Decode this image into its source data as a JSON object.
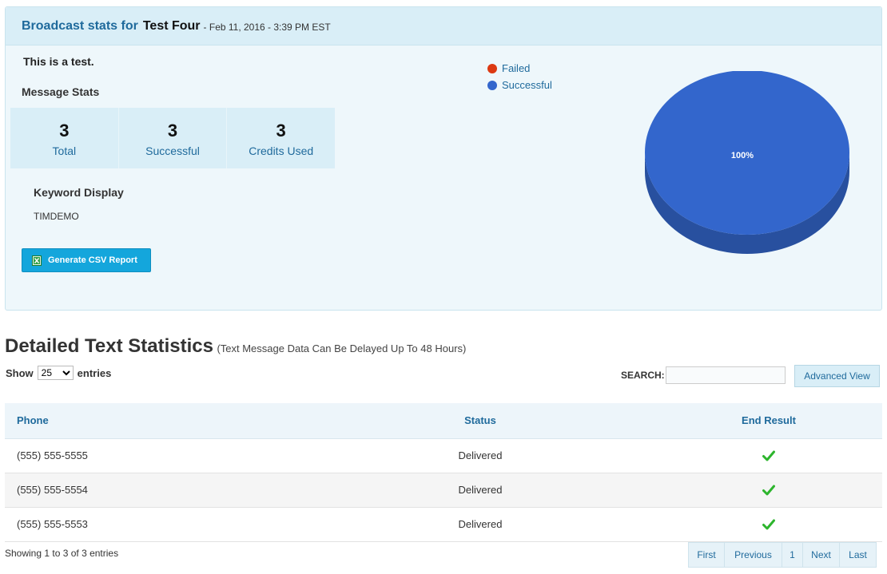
{
  "header": {
    "prefix": "Broadcast stats for",
    "name": "Test Four",
    "date": "- Feb 11, 2016 - 3:39 PM EST"
  },
  "description": "This is a test.",
  "message_stats": {
    "title": "Message Stats",
    "items": [
      {
        "value": "3",
        "label": "Total"
      },
      {
        "value": "3",
        "label": "Successful"
      },
      {
        "value": "3",
        "label": "Credits Used"
      }
    ]
  },
  "keyword": {
    "title": "Keyword Display",
    "value": "TIMDEMO"
  },
  "csv_button": {
    "label": "Generate CSV Report",
    "icon": "excel-icon"
  },
  "chart_data": {
    "type": "pie",
    "slices": [
      {
        "label": "Failed",
        "value": 0,
        "color": "#dc3912"
      },
      {
        "label": "Successful",
        "value": 100,
        "color": "#3366cc"
      }
    ],
    "data_label": "100%",
    "legend_position": "top-left",
    "style": "3d"
  },
  "detail": {
    "title": "Detailed Text Statistics",
    "subtitle": "(Text Message Data Can Be Delayed Up To 48 Hours)"
  },
  "length_control": {
    "show": "Show",
    "selected": "25",
    "entries": "entries"
  },
  "search": {
    "label": "SEARCH:",
    "value": ""
  },
  "advanced_view": "Advanced View",
  "table": {
    "columns": [
      "Phone",
      "Status",
      "End Result"
    ],
    "rows": [
      {
        "phone": "(555) 555-5555",
        "status": "Delivered",
        "result": "check-icon"
      },
      {
        "phone": "(555) 555-5554",
        "status": "Delivered",
        "result": "check-icon"
      },
      {
        "phone": "(555) 555-5553",
        "status": "Delivered",
        "result": "check-icon"
      }
    ]
  },
  "footer": {
    "info": "Showing 1 to 3 of 3 entries",
    "pager": [
      "First",
      "Previous",
      "1",
      "Next",
      "Last"
    ]
  },
  "colors": {
    "accent": "#1f6a9c",
    "button": "#14a6dc",
    "success": "#2db52d"
  }
}
